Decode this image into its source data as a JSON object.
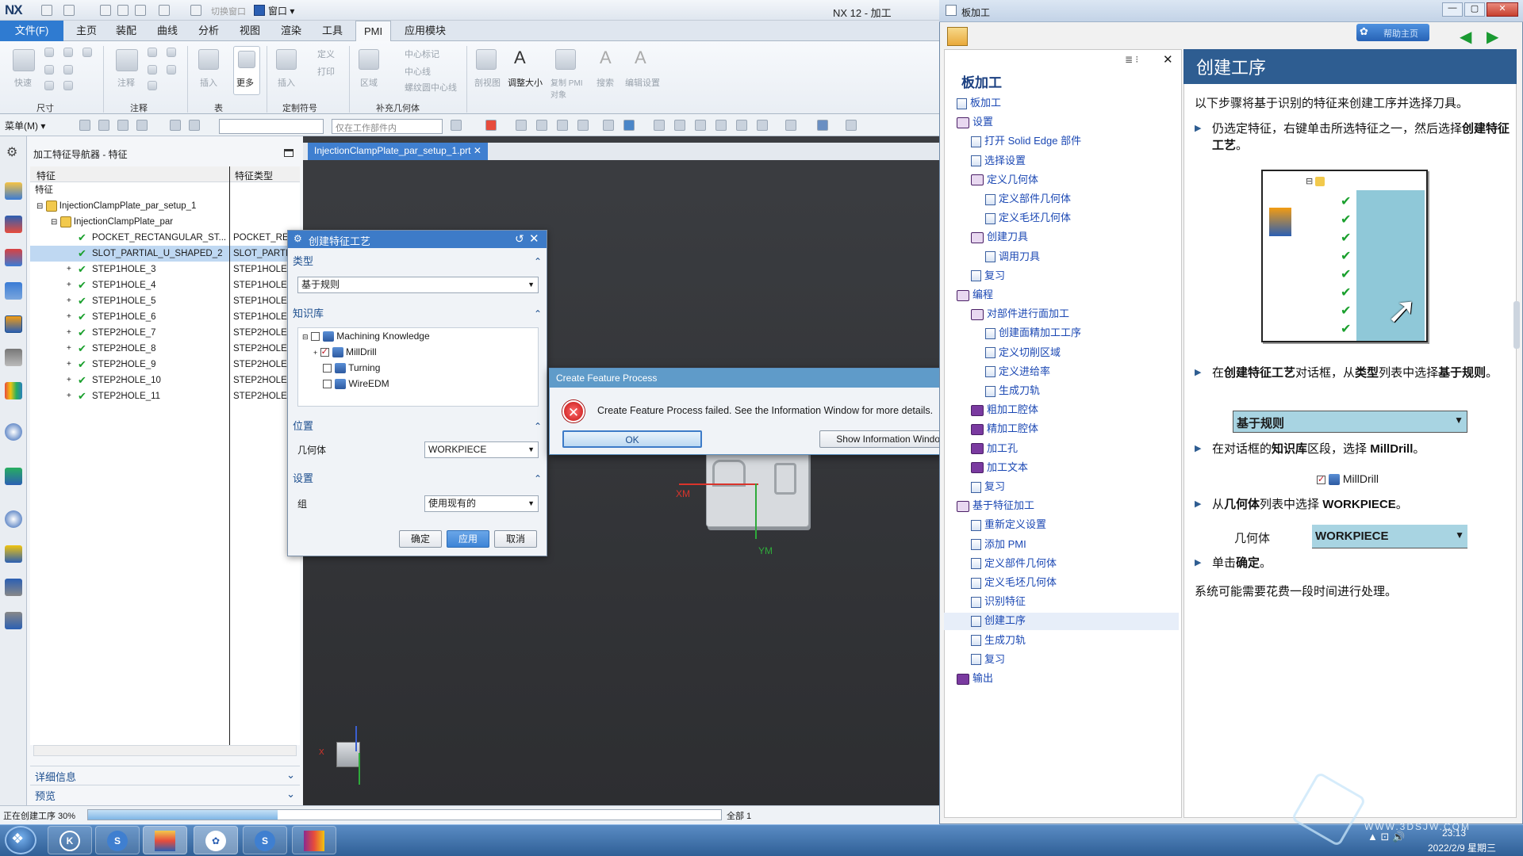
{
  "nx": {
    "logo": "NX",
    "title": "NX 12 - 加工",
    "window_menu": "窗口 ▾",
    "quick_access": [
      "切换窗口"
    ],
    "tabs": [
      "文件(F)",
      "主页",
      "装配",
      "曲线",
      "分析",
      "视图",
      "渲染",
      "工具",
      "PMI",
      "应用模块"
    ],
    "active_tab": "PMI",
    "ribbon_groups": [
      "尺寸",
      "注释",
      "表",
      "定制符号",
      "补充几何体"
    ],
    "ribbon_buttons": {
      "quick": "快速",
      "annotation": "注释",
      "insert": "插入",
      "more": "更多",
      "define": "定义",
      "print": "打印",
      "pmi_center": "中心标记",
      "centerline": "中心线",
      "thread": "螺纹圆中心线",
      "region": "区域",
      "section": "剖视图",
      "resize": "调整大小",
      "copy_pmi": "复制 PMI\n对象",
      "search": "搜索",
      "edit_settings": "编辑设置"
    },
    "menu_button": "菜单(M) ▾",
    "combo_filter": "仅在工作部件内",
    "status_text": "正在创建工序 30%",
    "status_right": "全部 1",
    "progress": 0.3
  },
  "navigator": {
    "title": "加工特征导航器 - 特征",
    "col_feature": "特征",
    "col_type": "特征类型",
    "root": "特征",
    "setup": "InjectionClampPlate_par_setup_1",
    "part": "InjectionClampPlate_par",
    "rows": [
      {
        "name": "POCKET_RECTANGULAR_ST...",
        "type": "POCKET_RE"
      },
      {
        "name": "SLOT_PARTIAL_U_SHAPED_2",
        "type": "SLOT_PARTI"
      },
      {
        "name": "STEP1HOLE_3",
        "type": "STEP1HOLE"
      },
      {
        "name": "STEP1HOLE_4",
        "type": "STEP1HOLE"
      },
      {
        "name": "STEP1HOLE_5",
        "type": "STEP1HOLE"
      },
      {
        "name": "STEP1HOLE_6",
        "type": "STEP1HOLE"
      },
      {
        "name": "STEP2HOLE_7",
        "type": "STEP2HOLE"
      },
      {
        "name": "STEP2HOLE_8",
        "type": "STEP2HOLE"
      },
      {
        "name": "STEP2HOLE_9",
        "type": "STEP2HOLE"
      },
      {
        "name": "STEP2HOLE_10",
        "type": "STEP2HOLE"
      },
      {
        "name": "STEP2HOLE_11",
        "type": "STEP2HOLE"
      }
    ],
    "details": "详细信息",
    "preview": "预览"
  },
  "viewport": {
    "doc_tab": "InjectionClampPlate_par_setup_1.prt",
    "axis_x": "XM",
    "axis_y": "YM",
    "triad_x": "X"
  },
  "cfp": {
    "title": "创建特征工艺",
    "type_label": "类型",
    "type_value": "基于规则",
    "kb_label": "知识库",
    "kb_items": [
      "Machining Knowledge",
      "MillDrill",
      "Turning",
      "WireEDM"
    ],
    "position_label": "位置",
    "geometry_label": "几何体",
    "geometry_value": "WORKPIECE",
    "settings_label": "设置",
    "group_label": "组",
    "group_value": "使用现有的",
    "ok": "确定",
    "apply": "应用",
    "cancel": "取消"
  },
  "error": {
    "title": "Create Feature Process",
    "message": "Create Feature Process failed. See the Information Window for more details.",
    "ok": "OK",
    "show_info": "Show Information Window"
  },
  "help": {
    "title": "板加工",
    "toc_heading": "板加工",
    "toc": [
      {
        "label": "板加工",
        "level": 0,
        "kind": "page"
      },
      {
        "label": "设置",
        "level": 0,
        "kind": "book"
      },
      {
        "label": "打开 Solid Edge 部件",
        "level": 1,
        "kind": "page"
      },
      {
        "label": "选择设置",
        "level": 1,
        "kind": "page"
      },
      {
        "label": "定义几何体",
        "level": 1,
        "kind": "book"
      },
      {
        "label": "定义部件几何体",
        "level": 2,
        "kind": "page"
      },
      {
        "label": "定义毛坯几何体",
        "level": 2,
        "kind": "page"
      },
      {
        "label": "创建刀具",
        "level": 1,
        "kind": "book"
      },
      {
        "label": "调用刀具",
        "level": 2,
        "kind": "page"
      },
      {
        "label": "复习",
        "level": 1,
        "kind": "page"
      },
      {
        "label": "编程",
        "level": 0,
        "kind": "book"
      },
      {
        "label": "对部件进行面加工",
        "level": 1,
        "kind": "book"
      },
      {
        "label": "创建面精加工工序",
        "level": 2,
        "kind": "page"
      },
      {
        "label": "定义切削区域",
        "level": 2,
        "kind": "page"
      },
      {
        "label": "定义进给率",
        "level": 2,
        "kind": "page"
      },
      {
        "label": "生成刀轨",
        "level": 2,
        "kind": "page"
      },
      {
        "label": "粗加工腔体",
        "level": 1,
        "kind": "closed"
      },
      {
        "label": "精加工腔体",
        "level": 1,
        "kind": "closed"
      },
      {
        "label": "加工孔",
        "level": 1,
        "kind": "closed"
      },
      {
        "label": "加工文本",
        "level": 1,
        "kind": "closed"
      },
      {
        "label": "复习",
        "level": 1,
        "kind": "page"
      },
      {
        "label": "基于特征加工",
        "level": 0,
        "kind": "book"
      },
      {
        "label": "重新定义设置",
        "level": 1,
        "kind": "page"
      },
      {
        "label": "添加 PMI",
        "level": 1,
        "kind": "page"
      },
      {
        "label": "定义部件几何体",
        "level": 1,
        "kind": "page"
      },
      {
        "label": "定义毛坯几何体",
        "level": 1,
        "kind": "page"
      },
      {
        "label": "识别特征",
        "level": 1,
        "kind": "page"
      },
      {
        "label": "创建工序",
        "level": 1,
        "kind": "page",
        "current": true
      },
      {
        "label": "生成刀轨",
        "level": 1,
        "kind": "page"
      },
      {
        "label": "复习",
        "level": 1,
        "kind": "page"
      },
      {
        "label": "输出",
        "level": 0,
        "kind": "closed"
      }
    ],
    "content_title": "创建工序",
    "intro": "以下步骤将基于识别的特征来创建工序并选择刀具。",
    "step1": [
      "仍选定特征，右键单击所选特征之一，然后选择",
      "创建特征工艺",
      "。"
    ],
    "step2": [
      "在",
      "创建特征工艺",
      "对话框，从",
      "类型",
      "列表中选择",
      "基于规则",
      "。"
    ],
    "fig_type_value": "基于规则",
    "step3": [
      "在对话框的",
      "知识库",
      "区段，选择 ",
      "MillDrill",
      "。"
    ],
    "fig_milldrill": "MillDrill",
    "step4": [
      "从",
      "几何体",
      "列表中选择 ",
      "WORKPIECE",
      "。"
    ],
    "fig_geom_label": "几何体",
    "fig_geom_value": "WORKPIECE",
    "step5": [
      "单击",
      "确定",
      "。"
    ],
    "outro": "系统可能需要花费一段时间进行处理。",
    "button_label": "帮助主页"
  },
  "taskbar": {
    "time": "23:13",
    "date": "2022/2/9 星期三",
    "watermark": "WWW.3DSJW.COM"
  },
  "colors": {
    "accent": "#2f7bd1",
    "help_header": "#2e5d91",
    "error": "#c41414",
    "check": "#1aa02d"
  }
}
